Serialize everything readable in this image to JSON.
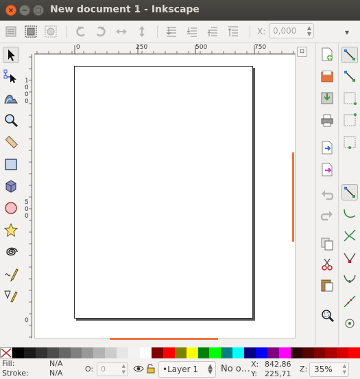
{
  "window": {
    "title": "New document 1 - Inkscape",
    "close_glyph": "×",
    "minimize_glyph": "−",
    "maximize_glyph": "□"
  },
  "toolbar": {
    "x_label": "X:",
    "x_value": "0,000",
    "more_glyph": "▾",
    "icons": [
      "edit-select-all-icon",
      "select-all-in-all-layers-icon",
      "deselect-icon",
      "rotate-ccw-icon",
      "rotate-cw-icon",
      "flip-horizontal-icon",
      "flip-vertical-icon",
      "lower-to-bottom-icon",
      "lower-icon",
      "raise-icon",
      "raise-to-top-icon"
    ]
  },
  "ruler": {
    "h_labels": [
      "0",
      "250",
      "500",
      "750"
    ],
    "v_labels": [
      "1\n0\n0\n0",
      "5\n0\n0",
      "0"
    ]
  },
  "tools": [
    "selector-tool-icon",
    "node-tool-icon",
    "tweak-tool-icon",
    "zoom-tool-icon",
    "measure-tool-icon",
    "rect-tool-icon",
    "3dbox-tool-icon",
    "ellipse-tool-icon",
    "star-tool-icon",
    "spiral-tool-icon",
    "pencil-tool-icon",
    "pen-tool-icon"
  ],
  "commands": [
    "new-document-icon",
    "open-document-icon",
    "save-document-icon",
    "print-document-icon",
    "import-icon",
    "export-icon",
    "undo-icon",
    "redo-icon",
    "copy-icon",
    "cut-icon",
    "paste-icon",
    "zoom-selection-icon"
  ],
  "snaps": [
    "snap-enable-icon",
    "snap-bbox-icon",
    "snap-bbox-edge-icon",
    "snap-bbox-corner-icon",
    "snap-bbox-midpoint-icon",
    "snap-nodes-icon",
    "snap-path-icon",
    "snap-path-intersection-icon",
    "snap-cusp-nodes-icon",
    "snap-smooth-nodes-icon",
    "snap-midpoints-icon",
    "snap-center-icon"
  ],
  "palette": {
    "none_icon": "no-paint-icon",
    "colors": [
      "#000000",
      "#1a1a1a",
      "#333333",
      "#4d4d4d",
      "#666666",
      "#808080",
      "#999999",
      "#b3b3b3",
      "#cccccc",
      "#e6e6e6",
      "#f2f2f2",
      "#ffffff",
      "#800000",
      "#ff0000",
      "#808000",
      "#ffff00",
      "#008000",
      "#00ff00",
      "#008080",
      "#00ffff",
      "#000080",
      "#0000ff",
      "#800080",
      "#ff00ff",
      "#2b0000",
      "#550000",
      "#800000",
      "#aa0000",
      "#d40000",
      "#ff0000"
    ]
  },
  "status": {
    "fill_label": "Fill:",
    "fill_value": "N/A",
    "stroke_label": "Stroke:",
    "stroke_value": "N/A",
    "opacity_label": "O:",
    "opacity_value": "0",
    "layer": "•Layer 1",
    "message": "No o…",
    "x_label": "X:",
    "x_value": "842,86",
    "y_label": "Y:",
    "y_value": "225,71",
    "zoom_label": "Z:",
    "zoom_value": "35%"
  }
}
